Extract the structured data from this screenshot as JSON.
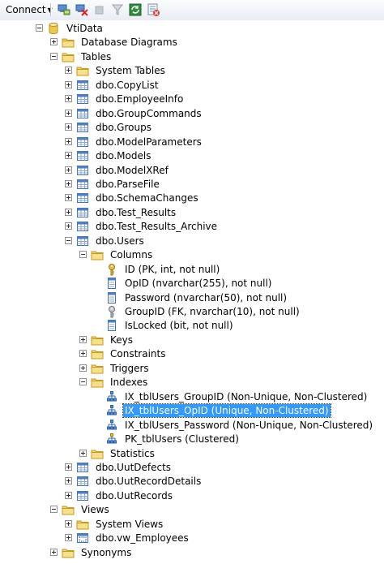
{
  "toolbar": {
    "connect_label": "Connect",
    "buttons": [
      {
        "name": "connect-object-explorer-icon"
      },
      {
        "name": "disconnect-icon"
      },
      {
        "name": "stop-icon"
      },
      {
        "name": "filter-icon"
      },
      {
        "name": "refresh-icon"
      },
      {
        "name": "clear-filter-icon"
      }
    ]
  },
  "tree": {
    "nodes": [
      {
        "label": "VtiData",
        "level": 1,
        "expander": "minus",
        "icon": "database"
      },
      {
        "label": "Database Diagrams",
        "level": 2,
        "expander": "plus",
        "icon": "folder"
      },
      {
        "label": "Tables",
        "level": 2,
        "expander": "minus",
        "icon": "folder"
      },
      {
        "label": "System Tables",
        "level": 3,
        "expander": "plus",
        "icon": "folder"
      },
      {
        "label": "dbo.CopyList",
        "level": 3,
        "expander": "plus",
        "icon": "table"
      },
      {
        "label": "dbo.EmployeeInfo",
        "level": 3,
        "expander": "plus",
        "icon": "table"
      },
      {
        "label": "dbo.GroupCommands",
        "level": 3,
        "expander": "plus",
        "icon": "table"
      },
      {
        "label": "dbo.Groups",
        "level": 3,
        "expander": "plus",
        "icon": "table"
      },
      {
        "label": "dbo.ModelParameters",
        "level": 3,
        "expander": "plus",
        "icon": "table"
      },
      {
        "label": "dbo.Models",
        "level": 3,
        "expander": "plus",
        "icon": "table"
      },
      {
        "label": "dbo.ModelXRef",
        "level": 3,
        "expander": "plus",
        "icon": "table"
      },
      {
        "label": "dbo.ParseFile",
        "level": 3,
        "expander": "plus",
        "icon": "table"
      },
      {
        "label": "dbo.SchemaChanges",
        "level": 3,
        "expander": "plus",
        "icon": "table"
      },
      {
        "label": "dbo.Test_Results",
        "level": 3,
        "expander": "plus",
        "icon": "table"
      },
      {
        "label": "dbo.Test_Results_Archive",
        "level": 3,
        "expander": "plus",
        "icon": "table"
      },
      {
        "label": "dbo.Users",
        "level": 3,
        "expander": "minus",
        "icon": "table"
      },
      {
        "label": "Columns",
        "level": 4,
        "expander": "minus",
        "icon": "folder"
      },
      {
        "label": "ID (PK, int, not null)",
        "level": 5,
        "expander": "none",
        "icon": "key-gold"
      },
      {
        "label": "OpID (nvarchar(255), not null)",
        "level": 5,
        "expander": "none",
        "icon": "column"
      },
      {
        "label": "Password (nvarchar(50), not null)",
        "level": 5,
        "expander": "none",
        "icon": "column"
      },
      {
        "label": "GroupID (FK, nvarchar(10), not null)",
        "level": 5,
        "expander": "none",
        "icon": "key-gray"
      },
      {
        "label": "IsLocked (bit, not null)",
        "level": 5,
        "expander": "none",
        "icon": "column"
      },
      {
        "label": "Keys",
        "level": 4,
        "expander": "plus",
        "icon": "folder"
      },
      {
        "label": "Constraints",
        "level": 4,
        "expander": "plus",
        "icon": "folder"
      },
      {
        "label": "Triggers",
        "level": 4,
        "expander": "plus",
        "icon": "folder"
      },
      {
        "label": "Indexes",
        "level": 4,
        "expander": "minus",
        "icon": "folder"
      },
      {
        "label": "IX_tblUsers_GroupID (Non-Unique, Non-Clustered)",
        "level": 5,
        "expander": "none",
        "icon": "index"
      },
      {
        "label": "IX_tblUsers_OpID (Unique, Non-Clustered)",
        "level": 5,
        "expander": "none",
        "icon": "index",
        "selected": true
      },
      {
        "label": "IX_tblUsers_Password (Non-Unique, Non-Clustered)",
        "level": 5,
        "expander": "none",
        "icon": "index"
      },
      {
        "label": "PK_tblUsers (Clustered)",
        "level": 5,
        "expander": "none",
        "icon": "index-pk"
      },
      {
        "label": "Statistics",
        "level": 4,
        "expander": "plus",
        "icon": "folder"
      },
      {
        "label": "dbo.UutDefects",
        "level": 3,
        "expander": "plus",
        "icon": "table"
      },
      {
        "label": "dbo.UutRecordDetails",
        "level": 3,
        "expander": "plus",
        "icon": "table"
      },
      {
        "label": "dbo.UutRecords",
        "level": 3,
        "expander": "plus",
        "icon": "table"
      },
      {
        "label": "Views",
        "level": 2,
        "expander": "minus",
        "icon": "folder"
      },
      {
        "label": "System Views",
        "level": 3,
        "expander": "plus",
        "icon": "folder"
      },
      {
        "label": "dbo.vw_Employees",
        "level": 3,
        "expander": "plus",
        "icon": "view"
      },
      {
        "label": "Synonyms",
        "level": 2,
        "expander": "plus",
        "icon": "folder"
      }
    ]
  },
  "colors": {
    "selection": "#3399ff",
    "folder": "#f2d36b",
    "table_header": "#4d7fc9"
  }
}
